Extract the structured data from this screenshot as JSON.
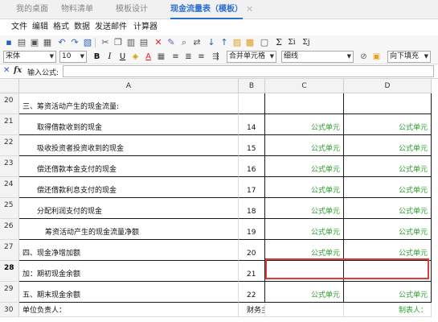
{
  "tabs": [
    {
      "label": "我的桌面",
      "active": false
    },
    {
      "label": "物料清单",
      "active": false
    },
    {
      "label": "模板设计",
      "active": false
    },
    {
      "label": "现金流量表（模板）",
      "active": true
    }
  ],
  "tab_close_glyph": "✕",
  "menu": [
    "文件",
    "编辑",
    "格式",
    "数据",
    "发送邮件",
    "计算器"
  ],
  "toolbar": {
    "font_name": "宋体",
    "font_size": "10",
    "bold": "B",
    "italic": "I",
    "underline": "U",
    "merge_select": "合并单元格",
    "border_select": "细线",
    "fill_select": "向下填充",
    "sum_label": "Σ",
    "sum_label2": "Σi",
    "sum_label3": "Σj"
  },
  "formula_bar": {
    "label": "输入公式:",
    "value": ""
  },
  "columns": [
    "A",
    "B",
    "C",
    "D"
  ],
  "rows": [
    {
      "num": "20",
      "a": "三、筹资活动产生的现金流量:",
      "indent": 0,
      "b": "",
      "c": "",
      "d": ""
    },
    {
      "num": "21",
      "a": "取得借款收到的现金",
      "indent": 1,
      "b": "14",
      "c": "公式单元",
      "d": "公式单元"
    },
    {
      "num": "22",
      "a": "吸收投资者投资收到的现金",
      "indent": 1,
      "b": "15",
      "c": "公式单元",
      "d": "公式单元"
    },
    {
      "num": "23",
      "a": "偿还借款本金支付的现金",
      "indent": 1,
      "b": "16",
      "c": "公式单元",
      "d": "公式单元"
    },
    {
      "num": "24",
      "a": "偿还借款利息支付的现金",
      "indent": 1,
      "b": "17",
      "c": "公式单元",
      "d": "公式单元"
    },
    {
      "num": "25",
      "a": "分配利润支付的现金",
      "indent": 1,
      "b": "18",
      "c": "公式单元",
      "d": "公式单元"
    },
    {
      "num": "26",
      "a": "筹资活动产生的现金流量净额",
      "indent": 2,
      "b": "19",
      "c": "公式单元",
      "d": "公式单元"
    },
    {
      "num": "27",
      "a": "四、现金净增加额",
      "indent": 0,
      "b": "20",
      "c": "公式单元",
      "d": "公式单元"
    },
    {
      "num": "28",
      "a": "加：期初现金余额",
      "indent": 0,
      "b": "21",
      "c": "",
      "d": ""
    },
    {
      "num": "29",
      "a": "五、期末现金余额",
      "indent": 0,
      "b": "22",
      "c": "公式单元",
      "d": "公式单元"
    },
    {
      "num": "30",
      "a": "单位负责人：",
      "indent": 0,
      "b": "财务主管：",
      "c": "",
      "d": "制表人："
    }
  ],
  "active_row": "28",
  "colors": {
    "accent": "#2d6fd0",
    "formula_text": "#2e9e2e",
    "selection": "#e03a3a"
  }
}
